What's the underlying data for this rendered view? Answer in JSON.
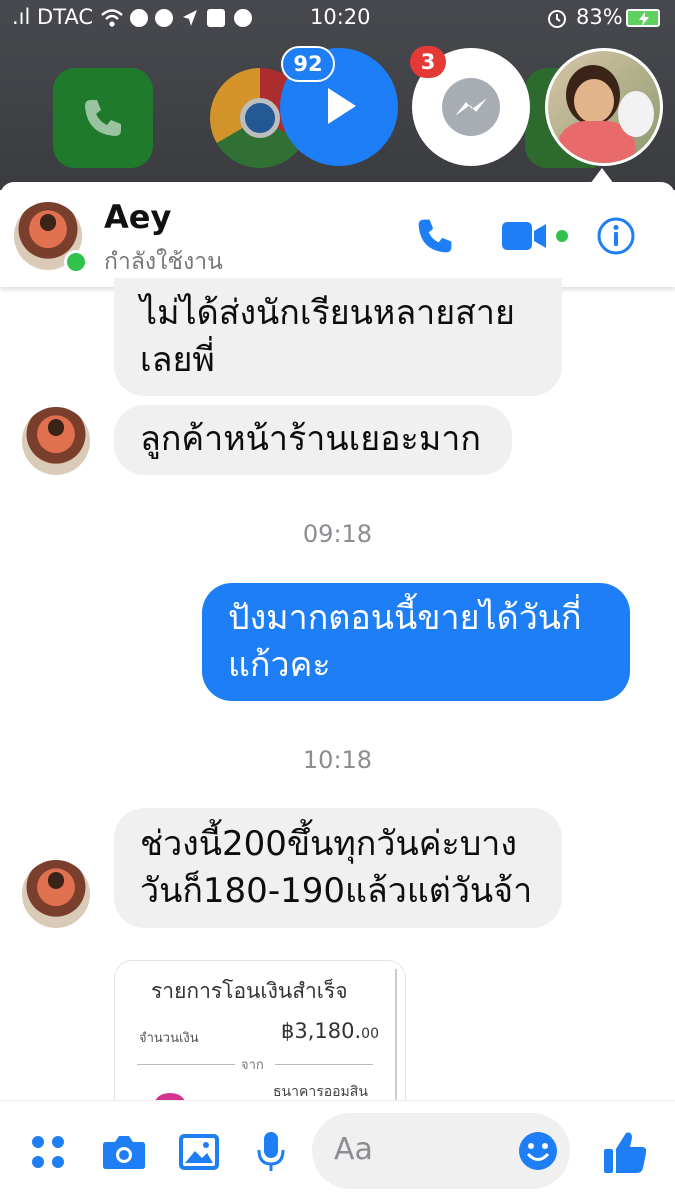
{
  "status_bar": {
    "carrier": ".ıl DTAC",
    "time": "10:20",
    "battery": "83%"
  },
  "chat_heads": {
    "video_badge": "92",
    "messenger_badge": "3"
  },
  "chat_header": {
    "name": "Aey",
    "status": "กำลังใช้งาน"
  },
  "messages": {
    "m1_line1": "ไม่ได้ส่งนักเรียนหลายสาย",
    "m1_line2": "เลยพี่",
    "m2": "ลูกค้าหน้าร้านเยอะมาก",
    "ts1": "09:18",
    "m3_line1": "ปังมากตอนนี้ขายได้วันกี่",
    "m3_line2": "แก้วคะ",
    "ts2": "10:18",
    "m4_line1": "ช่วงนี้200ขึ้นทุกวันค่ะบาง",
    "m4_line2": "วันก็180-190แล้วแต่วันจ้า"
  },
  "receipt": {
    "title": "รายการโอนเงินสำเร็จ",
    "amount_label": "จำนวนเงิน",
    "amount_value": "฿3,180.",
    "amount_cents": "00",
    "from_label": "จาก",
    "bank": "ธนาคารออมสิน"
  },
  "composer": {
    "placeholder": "Aa"
  },
  "colors": {
    "messenger_blue": "#1d7ef5",
    "online_green": "#31c24d",
    "incoming_bubble": "#f0f0f0"
  }
}
